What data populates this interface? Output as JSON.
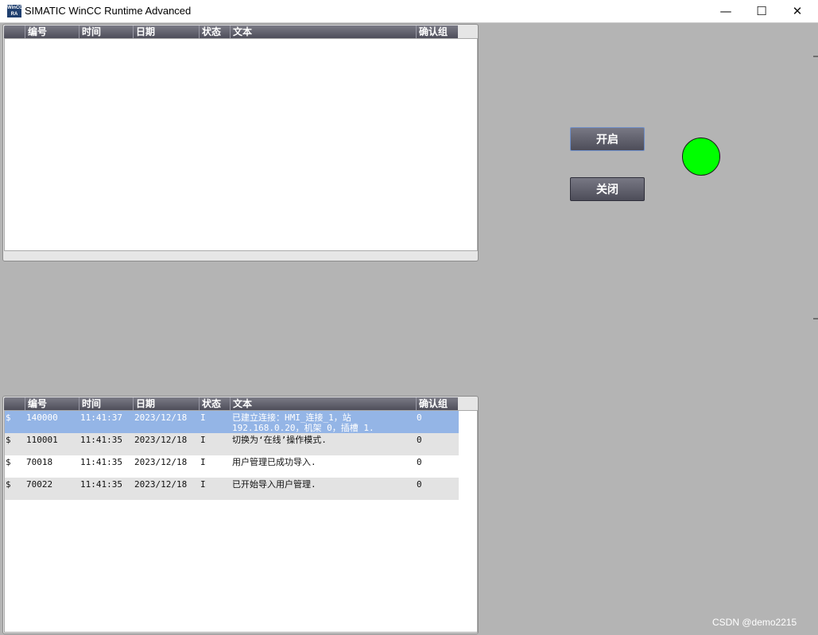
{
  "window": {
    "icon_text": "WinCC RA",
    "title": "SIMATIC WinCC Runtime Advanced",
    "minimize": "—",
    "maximize": "☐",
    "close": "✕"
  },
  "alarm_columns": [
    "编号",
    "时间",
    "日期",
    "状态",
    "文本",
    "确认组"
  ],
  "alarm_top": {
    "rows": []
  },
  "alarm_bottom": {
    "rows": [
      {
        "flag": "$",
        "id": "140000",
        "time": "11:41:37",
        "date": "2023/12/18",
        "state": "I",
        "text": "已建立连接：HMI_连接_1，站 192.168.0.20，机架 0，插槽 1.",
        "ack_group": "0"
      },
      {
        "flag": "$",
        "id": "110001",
        "time": "11:41:35",
        "date": "2023/12/18",
        "state": "I",
        "text": "切换为‘在线’操作模式.",
        "ack_group": "0"
      },
      {
        "flag": "$",
        "id": "70018",
        "time": "11:41:35",
        "date": "2023/12/18",
        "state": "I",
        "text": "用户管理已成功导入.",
        "ack_group": "0"
      },
      {
        "flag": "$",
        "id": "70022",
        "time": "11:41:35",
        "date": "2023/12/18",
        "state": "I",
        "text": "已开始导入用户管理.",
        "ack_group": "0"
      }
    ]
  },
  "controls": {
    "open_label": "开启",
    "close_label": "关闭",
    "lamp_color": "#00ff00",
    "lamp_state": "on"
  },
  "watermark": "CSDN @demo2215"
}
